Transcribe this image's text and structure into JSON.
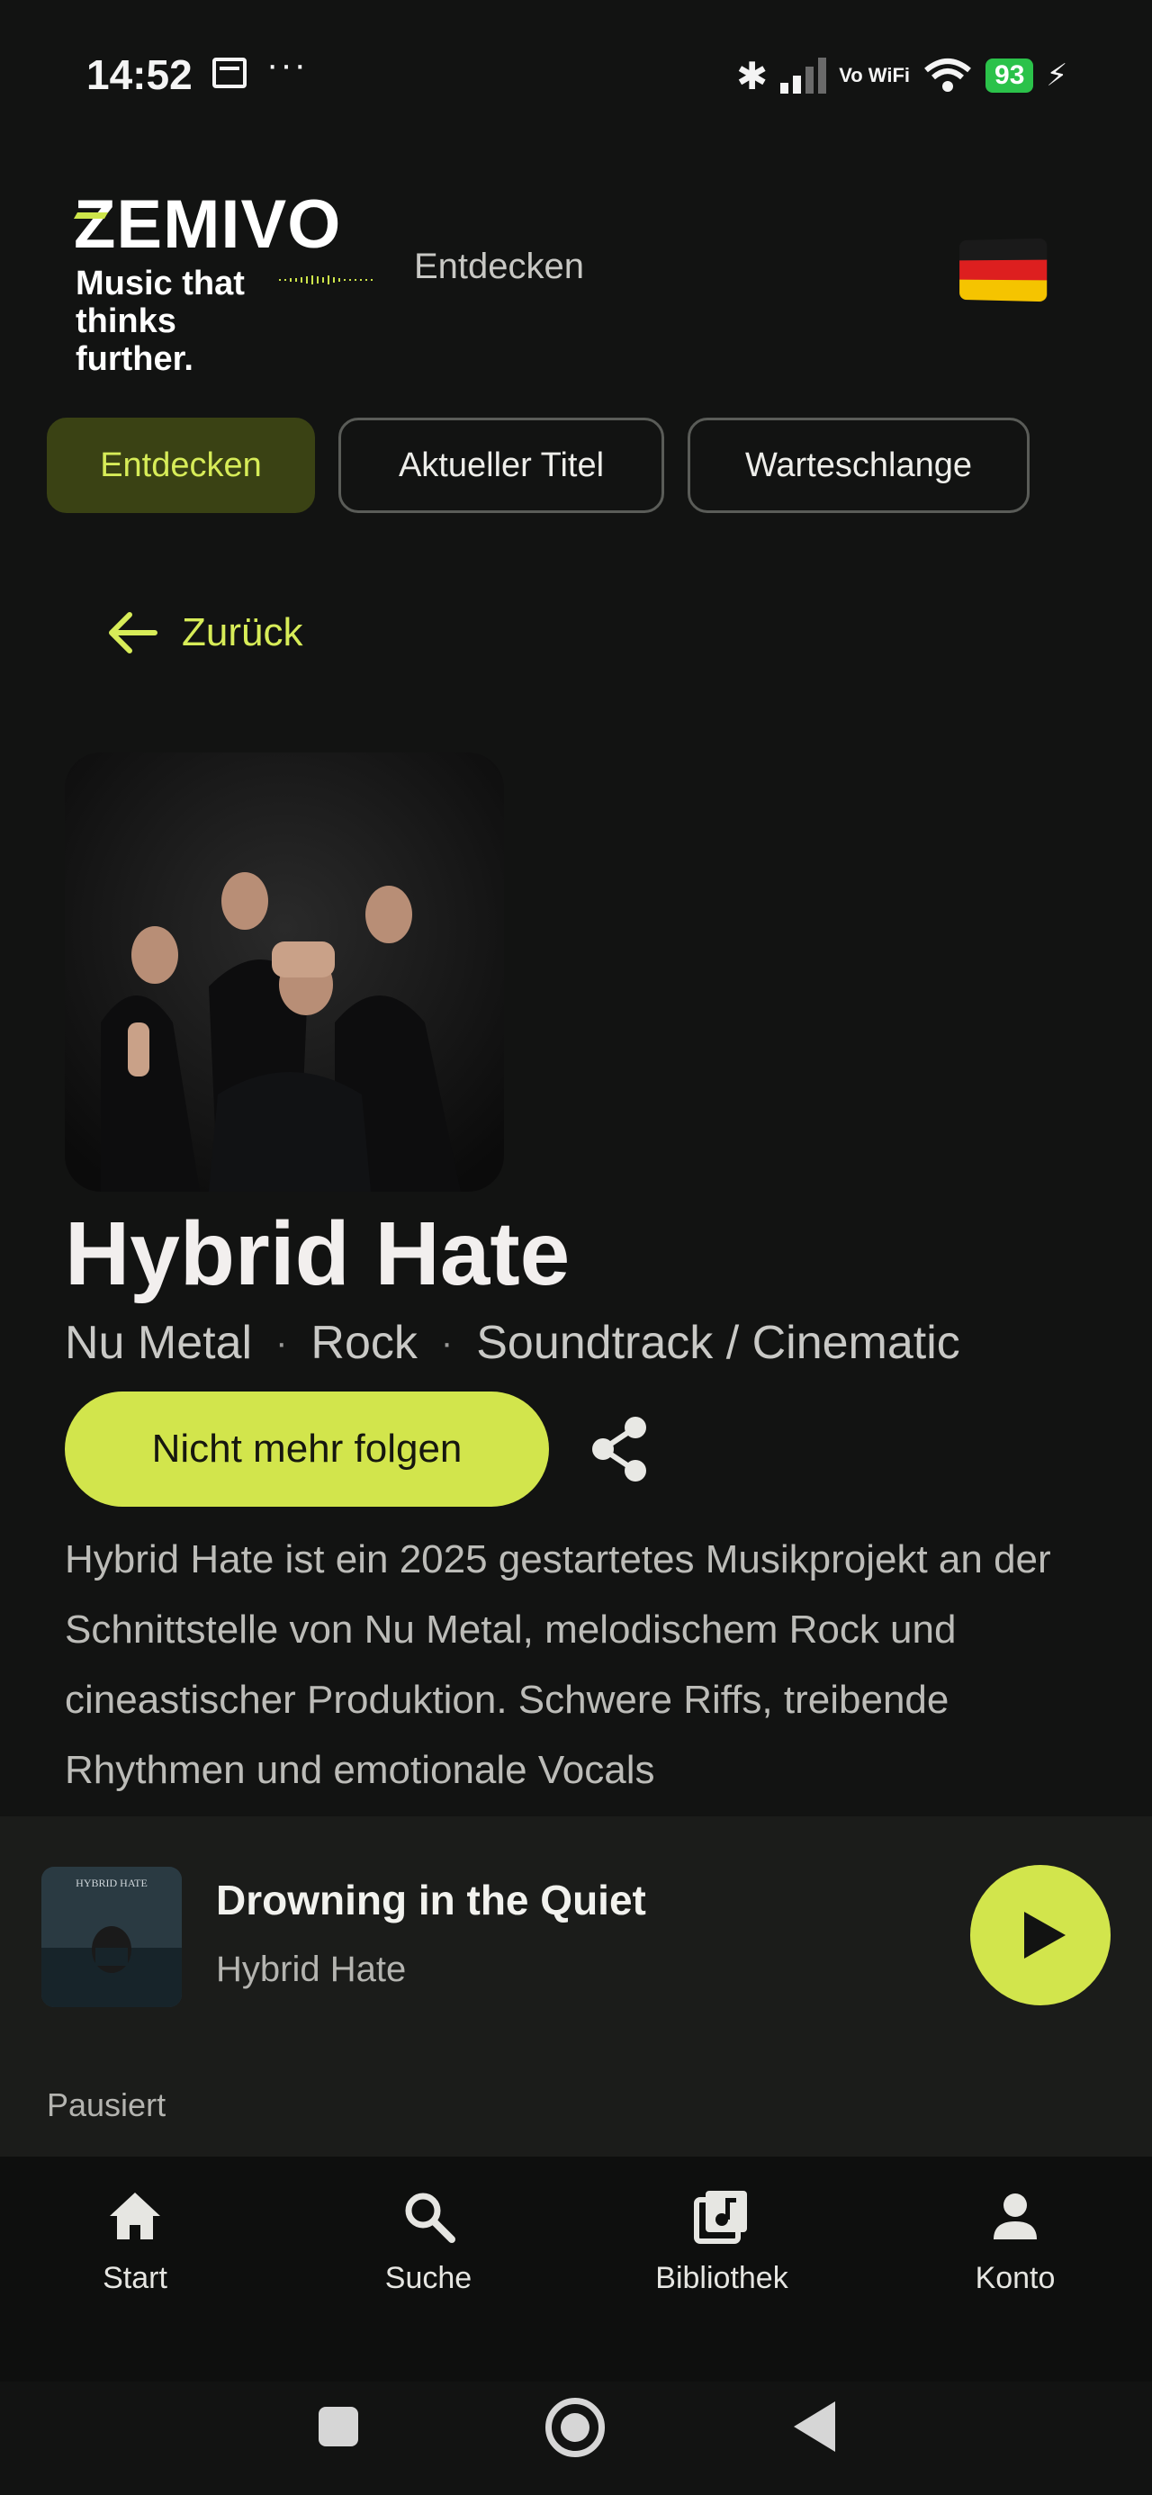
{
  "status_bar": {
    "time": "14:52",
    "dots": "···",
    "network": "Vo WiFi",
    "battery": "93"
  },
  "header": {
    "logo": "ZEMIVO",
    "tagline": "Music that thinks further.",
    "title": "Entdecken",
    "language_flag": "german-flag-icon"
  },
  "tabs": [
    {
      "label": "Entdecken",
      "active": true
    },
    {
      "label": "Aktueller Titel",
      "active": false
    },
    {
      "label": "Warteschlange",
      "active": false
    }
  ],
  "back_label": "Zurück",
  "artist": {
    "name": "Hybrid Hate",
    "genres": [
      "Nu Metal",
      "Rock",
      "Soundtrack / Cinematic"
    ],
    "genre_separator": "·",
    "follow_label": "Nicht mehr folgen",
    "description": "Hybrid Hate ist ein 2025 gestartetes Musikprojekt an der Schnittstelle von Nu Metal, melodischem Rock und cineastischer Produktion. Schwere Riffs, treibende Rhythmen und emotionale Vocals"
  },
  "now_playing": {
    "title": "Drowning in the Quiet",
    "artist": "Hybrid Hate",
    "state": "Pausiert",
    "cover_text": "HYBRID HATE"
  },
  "bottom_nav": [
    {
      "label": "Start",
      "icon": "home-icon"
    },
    {
      "label": "Suche",
      "icon": "search-icon"
    },
    {
      "label": "Bibliothek",
      "icon": "library-icon"
    },
    {
      "label": "Konto",
      "icon": "account-icon"
    }
  ],
  "colors": {
    "accent": "#d2e54c",
    "background": "#121312",
    "player_bg": "#1b1c1a",
    "active_tab_bg": "#3a4214"
  }
}
